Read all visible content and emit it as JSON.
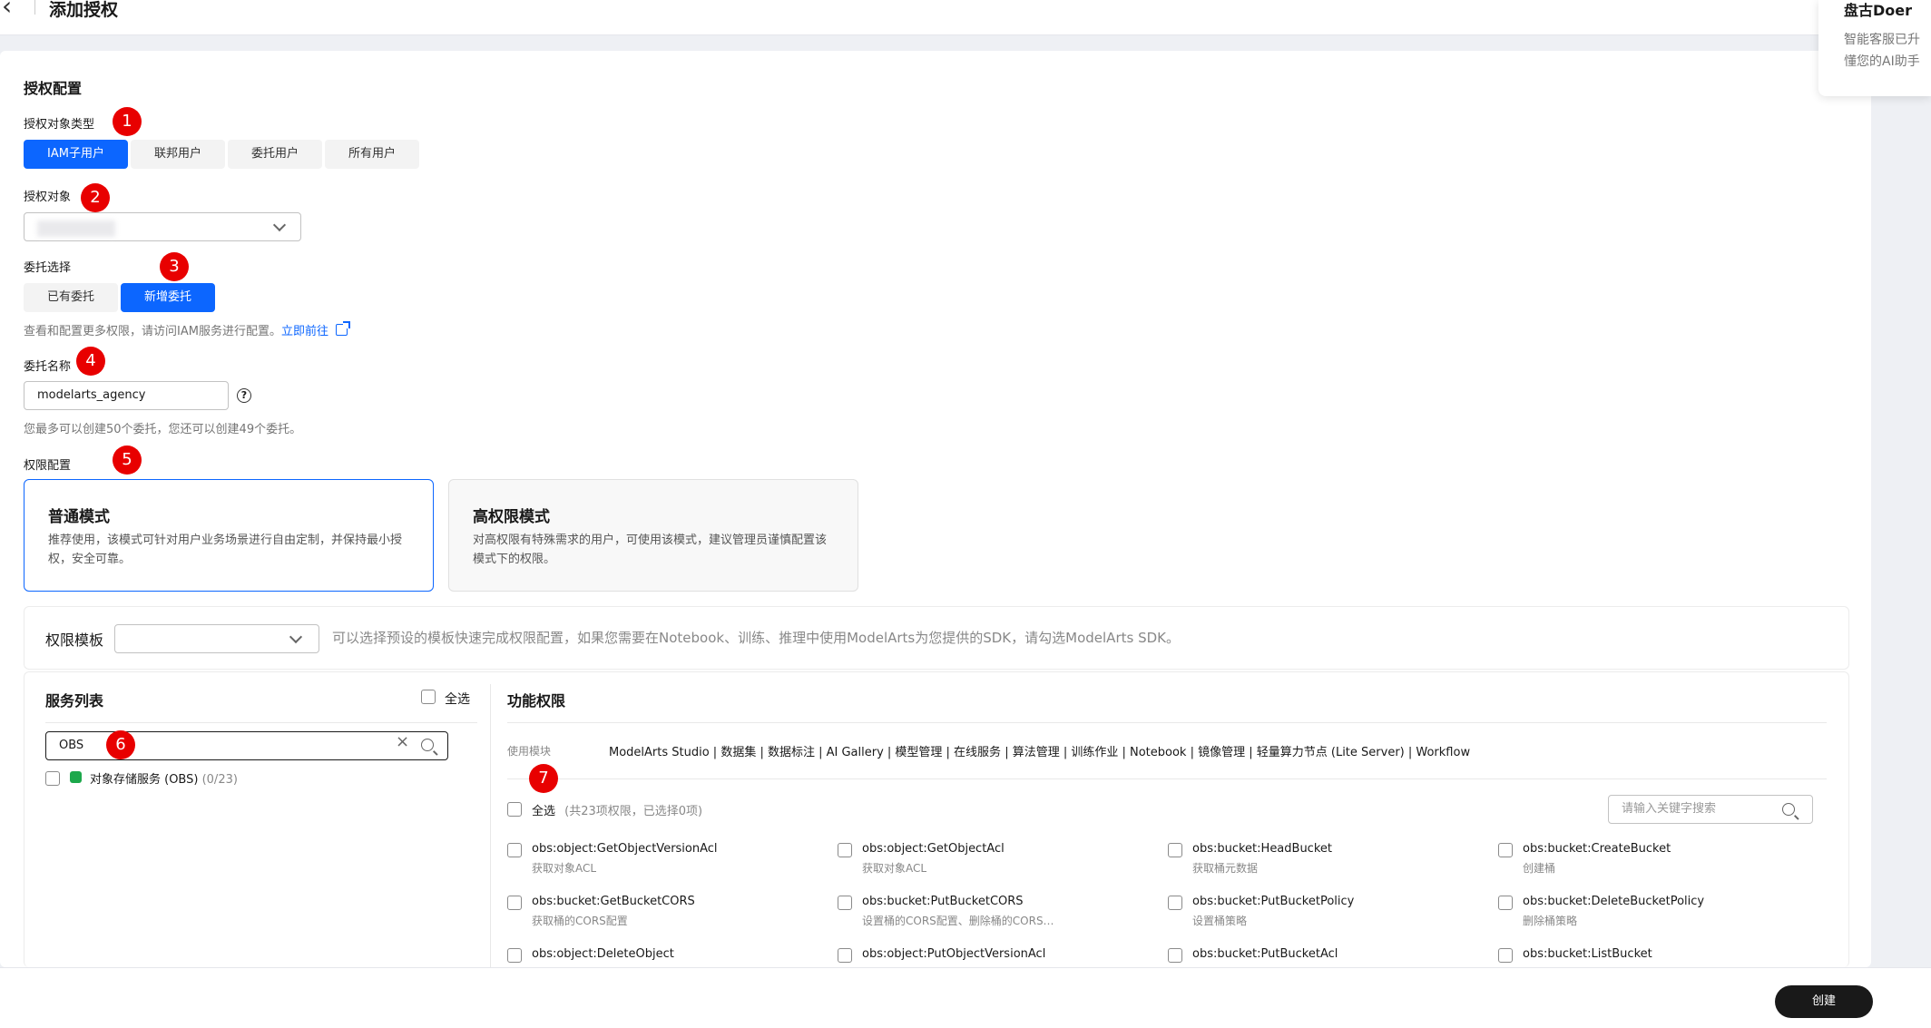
{
  "header": {
    "title": "添加授权",
    "back_icon": "‹"
  },
  "side_card": {
    "title": "盘古Doer",
    "line1": "智能客服已升",
    "line2": "懂您的AI助手"
  },
  "badges": [
    "1",
    "2",
    "3",
    "4",
    "5",
    "6",
    "7"
  ],
  "section_title": "授权配置",
  "principal_type": {
    "label": "授权对象类型",
    "options": [
      "IAM子用户",
      "联邦用户",
      "委托用户",
      "所有用户"
    ],
    "selected": "IAM子用户"
  },
  "principal": {
    "label": "授权对象"
  },
  "agency_choice": {
    "label": "委托选择",
    "options": [
      "已有委托",
      "新增委托"
    ],
    "selected": "新增委托",
    "hint": "查看和配置更多权限，请访问IAM服务进行配置。",
    "link": "立即前往"
  },
  "agency_name": {
    "label": "委托名称",
    "value": "modelarts_agency",
    "hint": "您最多可以创建50个委托，您还可以创建49个委托。"
  },
  "permission_config": {
    "label": "权限配置",
    "modes": [
      {
        "title": "普通模式",
        "desc": "推荐使用，该模式可针对用户业务场景进行自由定制，并保持最小授权，安全可靠。"
      },
      {
        "title": "高权限模式",
        "desc": "对高权限有特殊需求的用户，可使用该模式，建议管理员谨慎配置该模式下的权限。"
      }
    ]
  },
  "template": {
    "label": "权限模板",
    "hint": "可以选择预设的模板快速完成权限配置，如果您需要在Notebook、训练、推理中使用ModelArts为您提供的SDK，请勾选ModelArts SDK。"
  },
  "service_list": {
    "title": "服务列表",
    "select_all": "全选",
    "search_value": "OBS",
    "items": [
      {
        "name": "对象存储服务 (OBS)",
        "count": "(0/23)"
      }
    ]
  },
  "func_perms": {
    "title": "功能权限",
    "module_label": "使用模块",
    "modules": "ModelArts Studio | 数据集 | 数据标注 | AI Gallery | 模型管理 | 在线服务 | 算法管理 | 训练作业 | Notebook | 镜像管理 | 轻量算力节点 (Lite Server) | Workflow",
    "select_all": "全选",
    "count_text": "(共23项权限，已选择0项)",
    "search_placeholder": "请输入关键字搜索",
    "perms": [
      {
        "name": "obs:object:GetObjectVersionAcl",
        "desc": "获取对象ACL"
      },
      {
        "name": "obs:object:GetObjectAcl",
        "desc": "获取对象ACL"
      },
      {
        "name": "obs:bucket:HeadBucket",
        "desc": "获取桶元数据"
      },
      {
        "name": "obs:bucket:CreateBucket",
        "desc": "创建桶"
      },
      {
        "name": "obs:bucket:GetBucketCORS",
        "desc": "获取桶的CORS配置"
      },
      {
        "name": "obs:bucket:PutBucketCORS",
        "desc": "设置桶的CORS配置、删除桶的CORS…"
      },
      {
        "name": "obs:bucket:PutBucketPolicy",
        "desc": "设置桶策略"
      },
      {
        "name": "obs:bucket:DeleteBucketPolicy",
        "desc": "删除桶策略"
      },
      {
        "name": "obs:object:DeleteObject",
        "desc": ""
      },
      {
        "name": "obs:object:PutObjectVersionAcl",
        "desc": ""
      },
      {
        "name": "obs:bucket:PutBucketAcl",
        "desc": ""
      },
      {
        "name": "obs:bucket:ListBucket",
        "desc": ""
      }
    ]
  },
  "footer": {
    "create": "创建"
  }
}
